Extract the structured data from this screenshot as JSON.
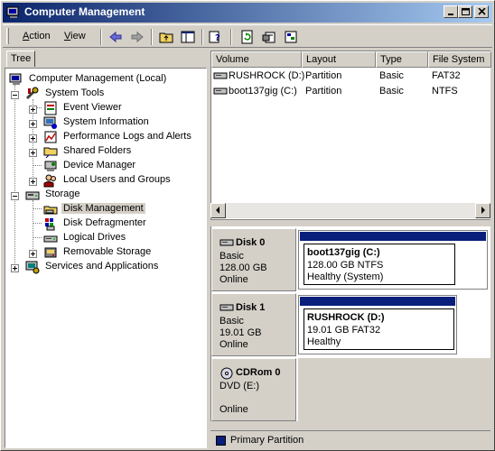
{
  "window": {
    "title": "Computer Management"
  },
  "menu": {
    "action": "Action",
    "action_key": "A",
    "action_rest": "ction",
    "view": "View",
    "view_key": "V",
    "view_rest": "iew"
  },
  "toolbar_icons": [
    "back-icon",
    "forward-icon",
    "up-folder-icon",
    "show-hide-tree-icon",
    "help-icon",
    "refresh-icon",
    "properties-icon",
    "connect-icon"
  ],
  "tree": {
    "tab_label": "Tree",
    "root": "Computer Management (Local)",
    "system_tools": "System Tools",
    "event_viewer": "Event Viewer",
    "system_information": "System Information",
    "performance_logs": "Performance Logs and Alerts",
    "shared_folders": "Shared Folders",
    "device_manager": "Device Manager",
    "local_users": "Local Users and Groups",
    "storage": "Storage",
    "disk_management": "Disk Management",
    "disk_defragmenter": "Disk Defragmenter",
    "logical_drives": "Logical Drives",
    "removable_storage": "Removable Storage",
    "services": "Services and Applications"
  },
  "volumes": {
    "columns": [
      "Volume",
      "Layout",
      "Type",
      "File System"
    ],
    "rows": [
      {
        "volume": "RUSHROCK (D:)",
        "layout": "Partition",
        "type": "Basic",
        "fs": "FAT32"
      },
      {
        "volume": "boot137gig (C:)",
        "layout": "Partition",
        "type": "Basic",
        "fs": "NTFS"
      }
    ]
  },
  "disks": [
    {
      "name": "Disk 0",
      "kind": "Basic",
      "size": "128.00 GB",
      "status": "Online",
      "partition": {
        "name": "boot137gig  (C:)",
        "detail": "128.00 GB NTFS",
        "health": "Healthy (System)"
      }
    },
    {
      "name": "Disk 1",
      "kind": "Basic",
      "size": "19.01 GB",
      "status": "Online",
      "partition": {
        "name": "RUSHROCK  (D:)",
        "detail": "19.01 GB FAT32",
        "health": "Healthy"
      }
    },
    {
      "name": "CDRom 0",
      "kind": "DVD (E:)",
      "status": "Online"
    }
  ],
  "legend": {
    "label": "Primary Partition",
    "color": "#0a1f7c"
  },
  "colors": {
    "titlebar_start": "#0a246a",
    "titlebar_end": "#a6caf0",
    "face": "#d4d0c8"
  }
}
